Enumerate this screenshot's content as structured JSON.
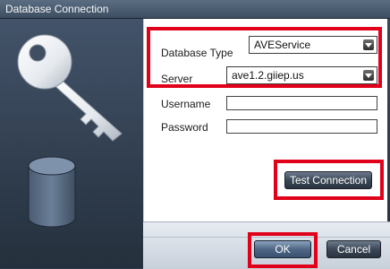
{
  "window": {
    "title": "Database Connection"
  },
  "form": {
    "database_type_label": "Database Type",
    "database_type_value": "AVEService",
    "server_label": "Server",
    "server_value": "ave1.2.giiep.us",
    "username_label": "Username",
    "username_value": "",
    "password_label": "Password",
    "password_value": ""
  },
  "buttons": {
    "test_connection": "Test Connection",
    "ok": "OK",
    "cancel": "Cancel"
  },
  "icons": {
    "key": "key-icon",
    "database": "database-icon"
  },
  "highlight_color": "#e0001a"
}
